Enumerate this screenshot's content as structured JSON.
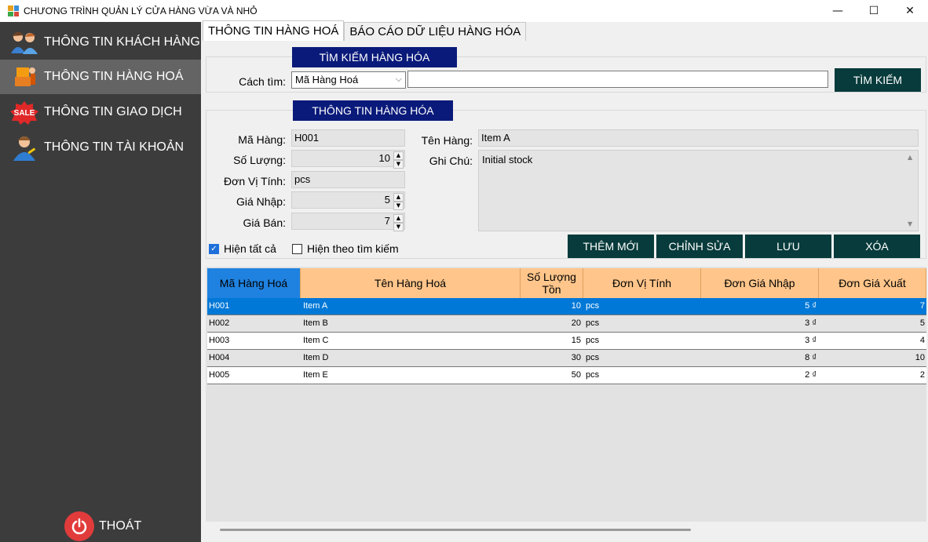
{
  "window": {
    "title": "CHƯƠNG TRÌNH QUẢN LÝ CỬA HÀNG VỪA VÀ NHỎ",
    "minimize": "—",
    "maximize": "☐",
    "close": "✕"
  },
  "sidebar": {
    "items": [
      {
        "label": "THÔNG TIN KHÁCH HÀNG",
        "icon": "customers-icon"
      },
      {
        "label": "THÔNG TIN HÀNG HOÁ",
        "icon": "delivery-icon"
      },
      {
        "label": "THÔNG TIN GIAO DỊCH",
        "icon": "sale-tag-icon"
      },
      {
        "label": "THÔNG TIN TÀI KHOẢN",
        "icon": "account-user-icon"
      }
    ],
    "sale_badge": "SALE",
    "exit_label": "THOÁT"
  },
  "tabs": [
    {
      "label": "THÔNG TIN HÀNG HOÁ",
      "active": true
    },
    {
      "label": "BÁO CÁO DỮ LIỆU HÀNG HÓA",
      "active": false
    }
  ],
  "search": {
    "section_title": "TÌM KIẾM HÀNG HÓA",
    "method_label": "Cách tìm:",
    "method_value": "Mã Hàng Hoá",
    "query_value": "",
    "button": "TÌM KIẾM"
  },
  "info": {
    "section_title": "THÔNG TIN HÀNG HÓA",
    "ma_hang_label": "Mã Hàng:",
    "ma_hang_value": "H001",
    "so_luong_label": "Số Lượng:",
    "so_luong_value": "10",
    "don_vi_label": "Đơn Vị Tính:",
    "don_vi_value": "pcs",
    "gia_nhap_label": "Giá Nhập:",
    "gia_nhap_value": "5",
    "gia_ban_label": "Giá Bán:",
    "gia_ban_value": "7",
    "ten_hang_label": "Tên Hàng:",
    "ten_hang_value": "Item A",
    "ghi_chu_label": "Ghi Chú:",
    "ghi_chu_value": "Initial stock"
  },
  "filters": {
    "show_all": "Hiện tất cả",
    "show_search": "Hiện theo tìm kiếm"
  },
  "actions": {
    "add": "THÊM MỚI",
    "edit": "CHỈNH SỬA",
    "save": "LƯU",
    "delete": "XÓA"
  },
  "grid": {
    "columns": [
      "Mã Hàng Hoá",
      "Tên Hàng Hoá",
      "Số Lượng Tồn",
      "Đơn Vị Tính",
      "Đơn Giá Nhập",
      "Đơn Giá Xuất"
    ],
    "rows": [
      {
        "ma": "H001",
        "ten": "Item A",
        "sl": "10",
        "dvt": "pcs",
        "nhap": "5 ₫",
        "xuat": "7"
      },
      {
        "ma": "H002",
        "ten": "Item B",
        "sl": "20",
        "dvt": "pcs",
        "nhap": "3 ₫",
        "xuat": "5"
      },
      {
        "ma": "H003",
        "ten": "Item C",
        "sl": "15",
        "dvt": "pcs",
        "nhap": "3 ₫",
        "xuat": "4"
      },
      {
        "ma": "H004",
        "ten": "Item D",
        "sl": "30",
        "dvt": "pcs",
        "nhap": "8 ₫",
        "xuat": "10"
      },
      {
        "ma": "H005",
        "ten": "Item E",
        "sl": "50",
        "dvt": "pcs",
        "nhap": "2 ₫",
        "xuat": "2"
      }
    ]
  },
  "colors": {
    "sidebar_bg": "#3c3c3c",
    "sidebar_active": "#646464",
    "section_label_bg": "#0a1a7a",
    "dark_button": "#083b3b",
    "grid_header": "#ffc58a",
    "grid_selected": "#0078d7"
  }
}
